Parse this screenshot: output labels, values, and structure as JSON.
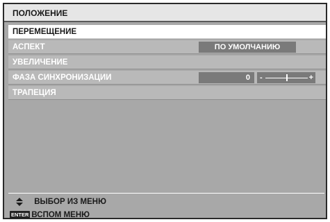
{
  "menu_title": "ПОЛОЖЕНИЕ",
  "items": [
    {
      "label": "ПЕРЕМЕЩЕНИЕ",
      "selected": true
    },
    {
      "label": "АСПЕКТ",
      "value": "ПО УМОЛЧАНИЮ"
    },
    {
      "label": "УВЕЛИЧЕНИЕ"
    },
    {
      "label": "ФАЗА СИНХРОНИЗАЦИИ",
      "value": "0",
      "slider": {
        "min_symbol": "-",
        "max_symbol": "+",
        "level": 0.5
      }
    },
    {
      "label": "ТРАПЕЦИЯ"
    }
  ],
  "footer": {
    "select_icon": "up-down-arrows-icon",
    "select_label": "ВЫБОР ИЗ МЕНЮ",
    "enter_key": "ENTER",
    "enter_label": "ВСПОМ МЕНЮ"
  },
  "colors": {
    "panel": "#a8a8a8",
    "selected_row": "#ffffff",
    "value_box": "#7a7a7a"
  }
}
